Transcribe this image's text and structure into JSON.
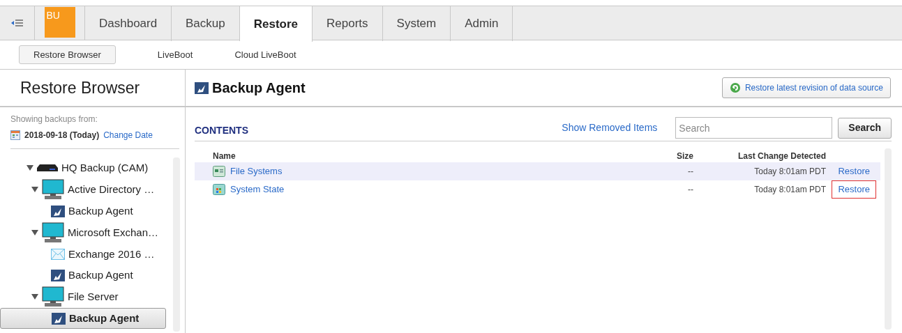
{
  "tabs": [
    {
      "label": "Dashboard",
      "selected": false
    },
    {
      "label": "Backup",
      "selected": false
    },
    {
      "label": "Restore",
      "selected": true
    },
    {
      "label": "Reports",
      "selected": false
    },
    {
      "label": "System",
      "selected": false
    },
    {
      "label": "Admin",
      "selected": false
    }
  ],
  "logo": "BU",
  "subnav": [
    {
      "label": "Restore Browser",
      "selected": true
    },
    {
      "label": "LiveBoot",
      "selected": false
    },
    {
      "label": "Cloud LiveBoot",
      "selected": false
    }
  ],
  "sidebar": {
    "title": "Restore Browser",
    "showing_label": "Showing backups from:",
    "date": "2018-09-18 (Today)",
    "change_date": "Change Date",
    "tree": [
      {
        "kind": "server",
        "label": "HQ Backup (CAM)",
        "expanded": true,
        "selected": false,
        "children": [
          {
            "kind": "computer",
            "label": "Active Directory …",
            "expanded": true,
            "selected": false,
            "children": [
              {
                "kind": "agent",
                "label": "Backup Agent",
                "selected": false
              }
            ]
          },
          {
            "kind": "computer",
            "label": "Microsoft Exchan…",
            "expanded": true,
            "selected": false,
            "children": [
              {
                "kind": "mail",
                "label": "Exchange 2016 …",
                "selected": false
              },
              {
                "kind": "agent",
                "label": "Backup Agent",
                "selected": false
              }
            ]
          },
          {
            "kind": "computer",
            "label": "File Server",
            "expanded": true,
            "selected": false,
            "children": [
              {
                "kind": "agent",
                "label": "Backup Agent",
                "selected": true
              }
            ]
          }
        ]
      }
    ]
  },
  "main": {
    "title": "Backup Agent",
    "restore_latest": "Restore latest revision of data source",
    "contents_label": "CONTENTS",
    "show_removed": "Show Removed Items",
    "search": {
      "placeholder": "Search"
    },
    "search_button": "Search",
    "table": {
      "columns": [
        "Name",
        "Size",
        "Last Change Detected"
      ],
      "rows": [
        {
          "kind": "filesystem",
          "name": "File Systems",
          "size": "--",
          "last_change": "Today 8:01am PDT",
          "action": "Restore",
          "highlighted": true,
          "outlined": false
        },
        {
          "kind": "systemstate",
          "name": "System State",
          "size": "--",
          "last_change": "Today 8:01am PDT",
          "action": "Restore",
          "highlighted": false,
          "outlined": true
        }
      ]
    }
  }
}
